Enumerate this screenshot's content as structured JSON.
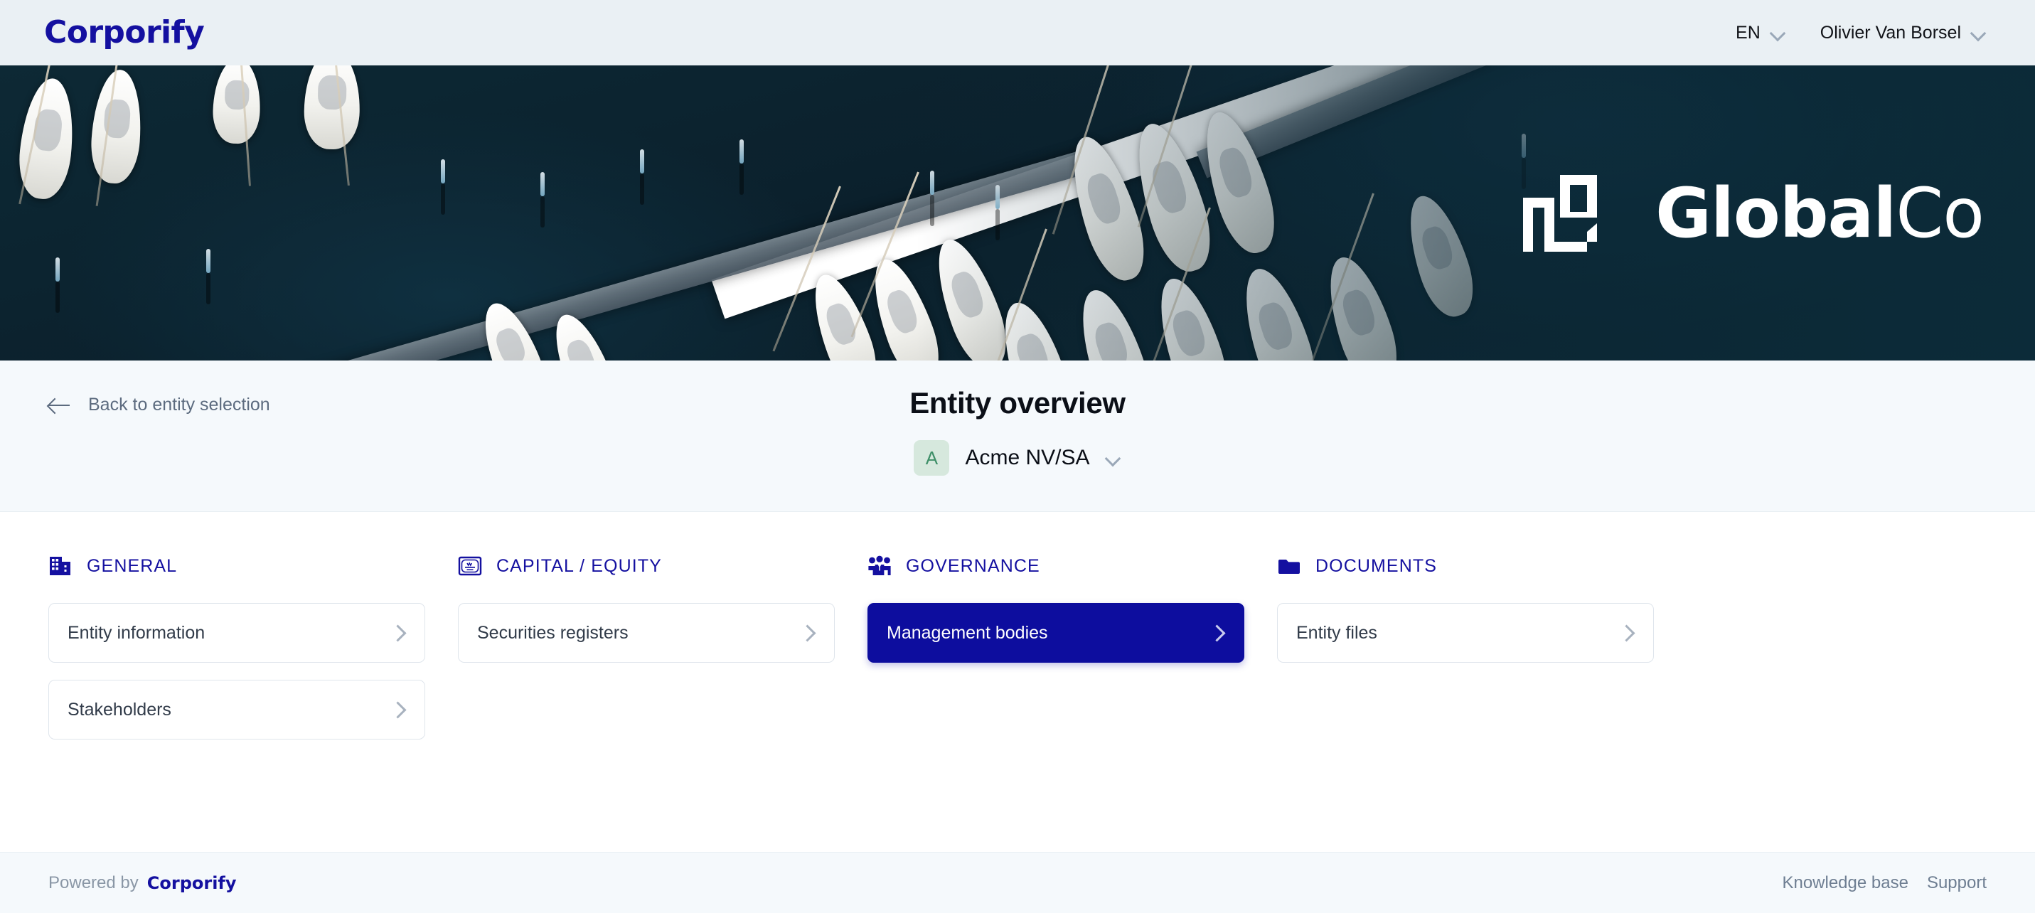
{
  "header": {
    "brand": "Corporify",
    "language": "EN",
    "language_icon": "chevron-down-icon",
    "user": "Olivier Van Borsel",
    "user_icon": "chevron-down-icon"
  },
  "hero": {
    "company_name_bold": "Global",
    "company_name_light": "Co",
    "logo_icon": "globalco-bracket-mark",
    "image_description": "aerial-marina-boats"
  },
  "subheader": {
    "back_label": "Back to entity selection",
    "back_icon": "arrow-left-icon",
    "title": "Entity overview",
    "entity_initial": "A",
    "entity_name": "Acme NV/SA",
    "entity_dropdown_icon": "chevron-down-icon"
  },
  "sections": [
    {
      "title": "GENERAL",
      "icon": "building-icon",
      "cards": [
        {
          "label": "Entity information",
          "icon": "chevron-right-icon",
          "active": false
        },
        {
          "label": "Stakeholders",
          "icon": "chevron-right-icon",
          "active": false
        }
      ]
    },
    {
      "title": "CAPITAL / EQUITY",
      "icon": "certificate-icon",
      "cards": [
        {
          "label": "Securities registers",
          "icon": "chevron-right-icon",
          "active": false
        }
      ]
    },
    {
      "title": "GOVERNANCE",
      "icon": "people-group-icon",
      "cards": [
        {
          "label": "Management bodies",
          "icon": "chevron-right-icon",
          "active": true
        }
      ]
    },
    {
      "title": "DOCUMENTS",
      "icon": "folder-icon",
      "cards": [
        {
          "label": "Entity files",
          "icon": "chevron-right-icon",
          "active": false
        }
      ]
    }
  ],
  "footer": {
    "powered_by": "Powered by",
    "brand": "Corporify",
    "links": [
      "Knowledge base",
      "Support"
    ]
  },
  "colors": {
    "brand_navy": "#1410a0",
    "active_card": "#0d0d9e",
    "header_bg": "#eaf0f4",
    "subheader_bg": "#f5f9fc",
    "card_border": "#dfe5ec",
    "avatar_bg": "#d6e8dd",
    "avatar_text": "#3e8f68"
  }
}
